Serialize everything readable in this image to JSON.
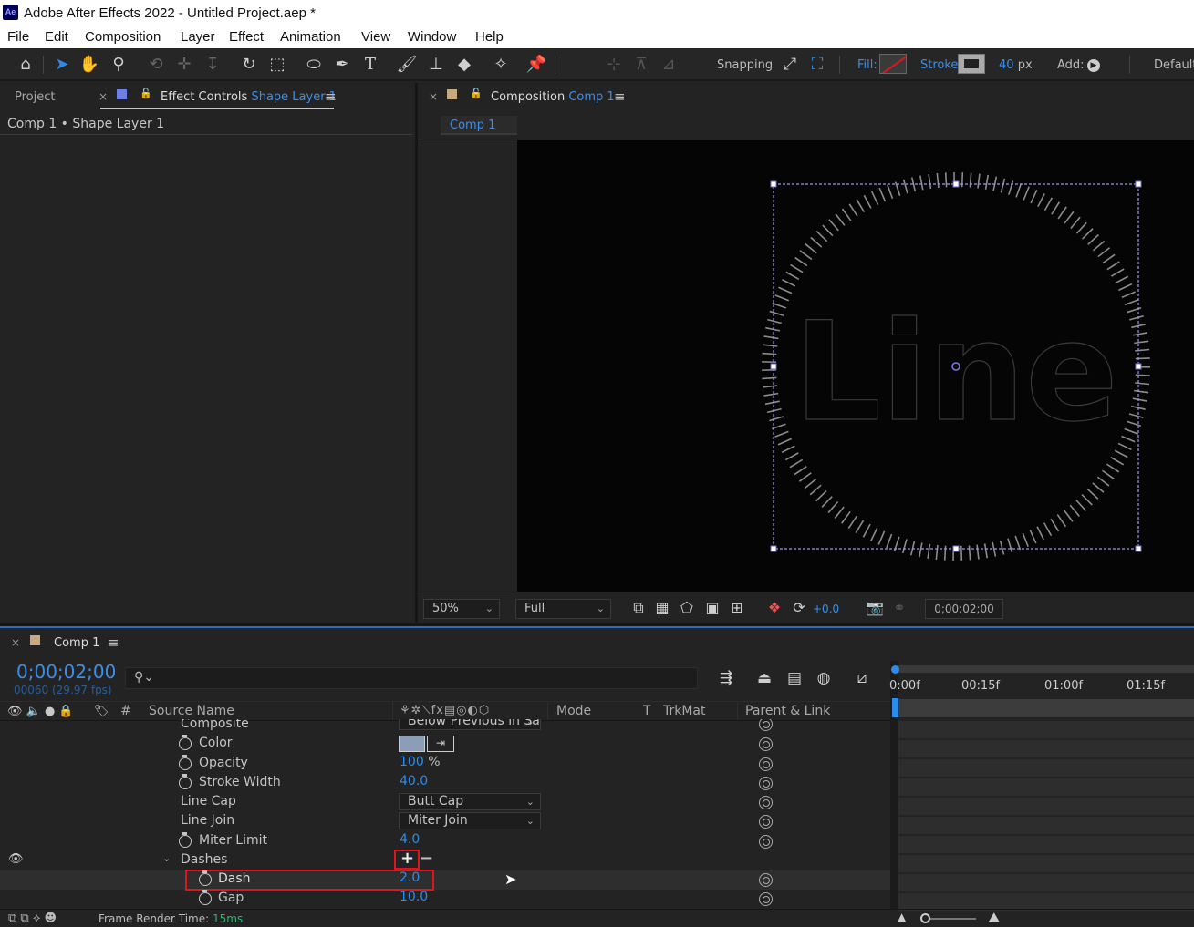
{
  "app": {
    "logo": "Ae",
    "title": "Adobe After Effects 2022 - Untitled Project.aep *"
  },
  "menu": [
    "File",
    "Edit",
    "Composition",
    "Layer",
    "Effect",
    "Animation",
    "View",
    "Window",
    "Help"
  ],
  "toolbar": {
    "snapping_label": "Snapping",
    "fill_label": "Fill:",
    "stroke_label": "Stroke:",
    "stroke_width": "40",
    "stroke_unit": "px",
    "add_label": "Add:",
    "workspace": "Default"
  },
  "left_panel": {
    "tab_project": "Project",
    "tab_effect_controls": "Effect Controls",
    "tab_effect_controls_layer": "Shape Layer 1",
    "breadcrumb": "Comp 1 • Shape Layer 1"
  },
  "comp_panel": {
    "tab_label": "Composition",
    "tab_comp_name": "Comp 1",
    "subtab": "Comp 1",
    "canvas_text": "Line",
    "zoom": "50%",
    "resolution": "Full",
    "exposure": "+0.0",
    "timecode": "0;00;02;00"
  },
  "timeline": {
    "tab": "Comp 1",
    "timecode": "0;00;02;00",
    "frame_info": "00060 (29.97 fps)",
    "search_placeholder": "",
    "columns": {
      "num": "#",
      "source_name": "Source Name",
      "mode": "Mode",
      "t": "T",
      "trkmat": "TrkMat",
      "parent": "Parent & Link"
    },
    "ruler": [
      "0:00f",
      "00:15f",
      "01:00f",
      "01:15f"
    ],
    "rows": [
      {
        "name": "Composite",
        "dropdown": "Below Previous in Sa"
      },
      {
        "name": "Color"
      },
      {
        "name": "Opacity",
        "value": "100",
        "unit": "%"
      },
      {
        "name": "Stroke Width",
        "value": "40.0"
      },
      {
        "name": "Line Cap",
        "dropdown": "Butt Cap"
      },
      {
        "name": "Line Join",
        "dropdown": "Miter Join"
      },
      {
        "name": "Miter Limit",
        "value": "4.0"
      },
      {
        "name": "Dashes",
        "add": "+",
        "remove": "−"
      },
      {
        "name": "Dash",
        "value": "2.0"
      },
      {
        "name": "Gap",
        "value": "10.0"
      }
    ],
    "footer_label": "Frame Render Time:",
    "footer_value": "15ms"
  },
  "colors": {
    "accent_blue": "#2d8ceb",
    "highlight_red": "#e0141b",
    "selection_box": "#9a9ae6"
  }
}
